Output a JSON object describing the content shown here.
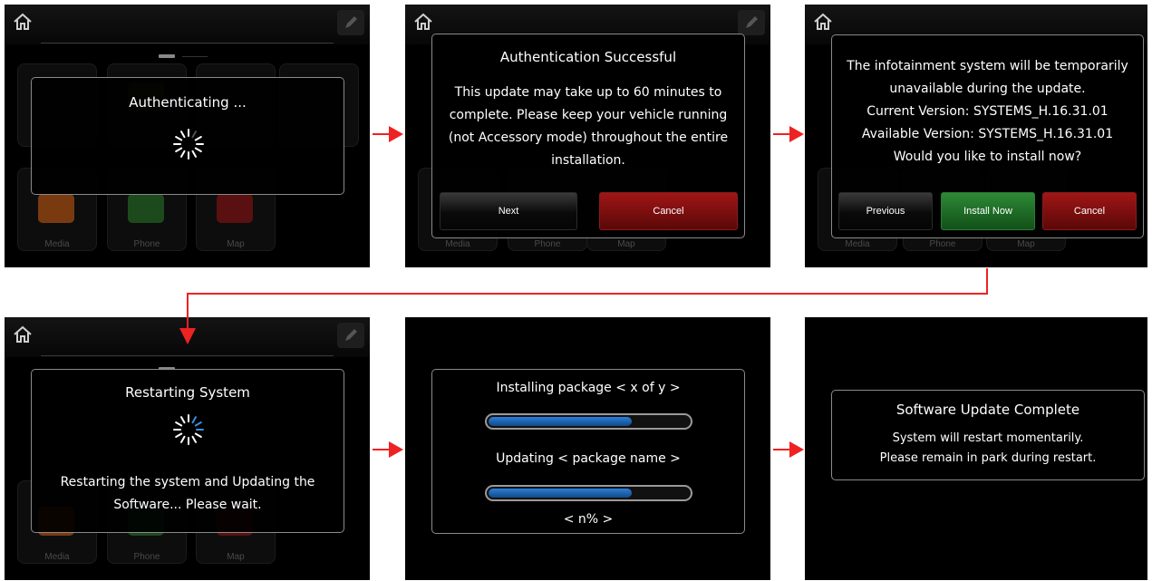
{
  "arrow_color": "#ee2222",
  "panels": {
    "p1": {
      "dialog_title": "Authenticating ...",
      "tiles": [
        "Media",
        "Phone",
        "Map"
      ],
      "icons": [
        "home-icon",
        "edit-icon",
        "spinner-icon"
      ]
    },
    "p2": {
      "dialog_title": "Authentication Successful",
      "lines": [
        "This update may take up to 60 minutes to",
        "complete. Please keep your vehicle running",
        "(not Accessory mode) throughout the entire",
        "installation."
      ],
      "next_label": "Next",
      "cancel_label": "Cancel",
      "tiles": [
        "Media",
        "Phone",
        "Map"
      ]
    },
    "p3": {
      "lines": [
        "The infotainment system will be temporarily",
        "unavailable during the update.",
        "Current Version: SYSTEMS_H.16.31.01",
        "Available Version: SYSTEMS_H.16.31.01",
        "Would you like to install now?"
      ],
      "previous_label": "Previous",
      "install_label": "Install Now",
      "cancel_label": "Cancel",
      "tiles": [
        "Media",
        "Phone",
        "Map"
      ]
    },
    "p4": {
      "dialog_title": "Restarting System",
      "lines": [
        "Restarting the system and Updating the",
        "Software... Please wait."
      ],
      "tiles": [
        "Media",
        "Phone",
        "Map"
      ]
    },
    "p5": {
      "package_label": "Installing package < x of y >",
      "update_label": "Updating < package name >",
      "percent_label": "< n% >",
      "package_progress": 0.72,
      "update_progress": 0.72
    },
    "p6": {
      "dialog_title": "Software Update Complete",
      "lines": [
        "System will restart momentarily.",
        "Please remain in park during restart."
      ]
    }
  }
}
